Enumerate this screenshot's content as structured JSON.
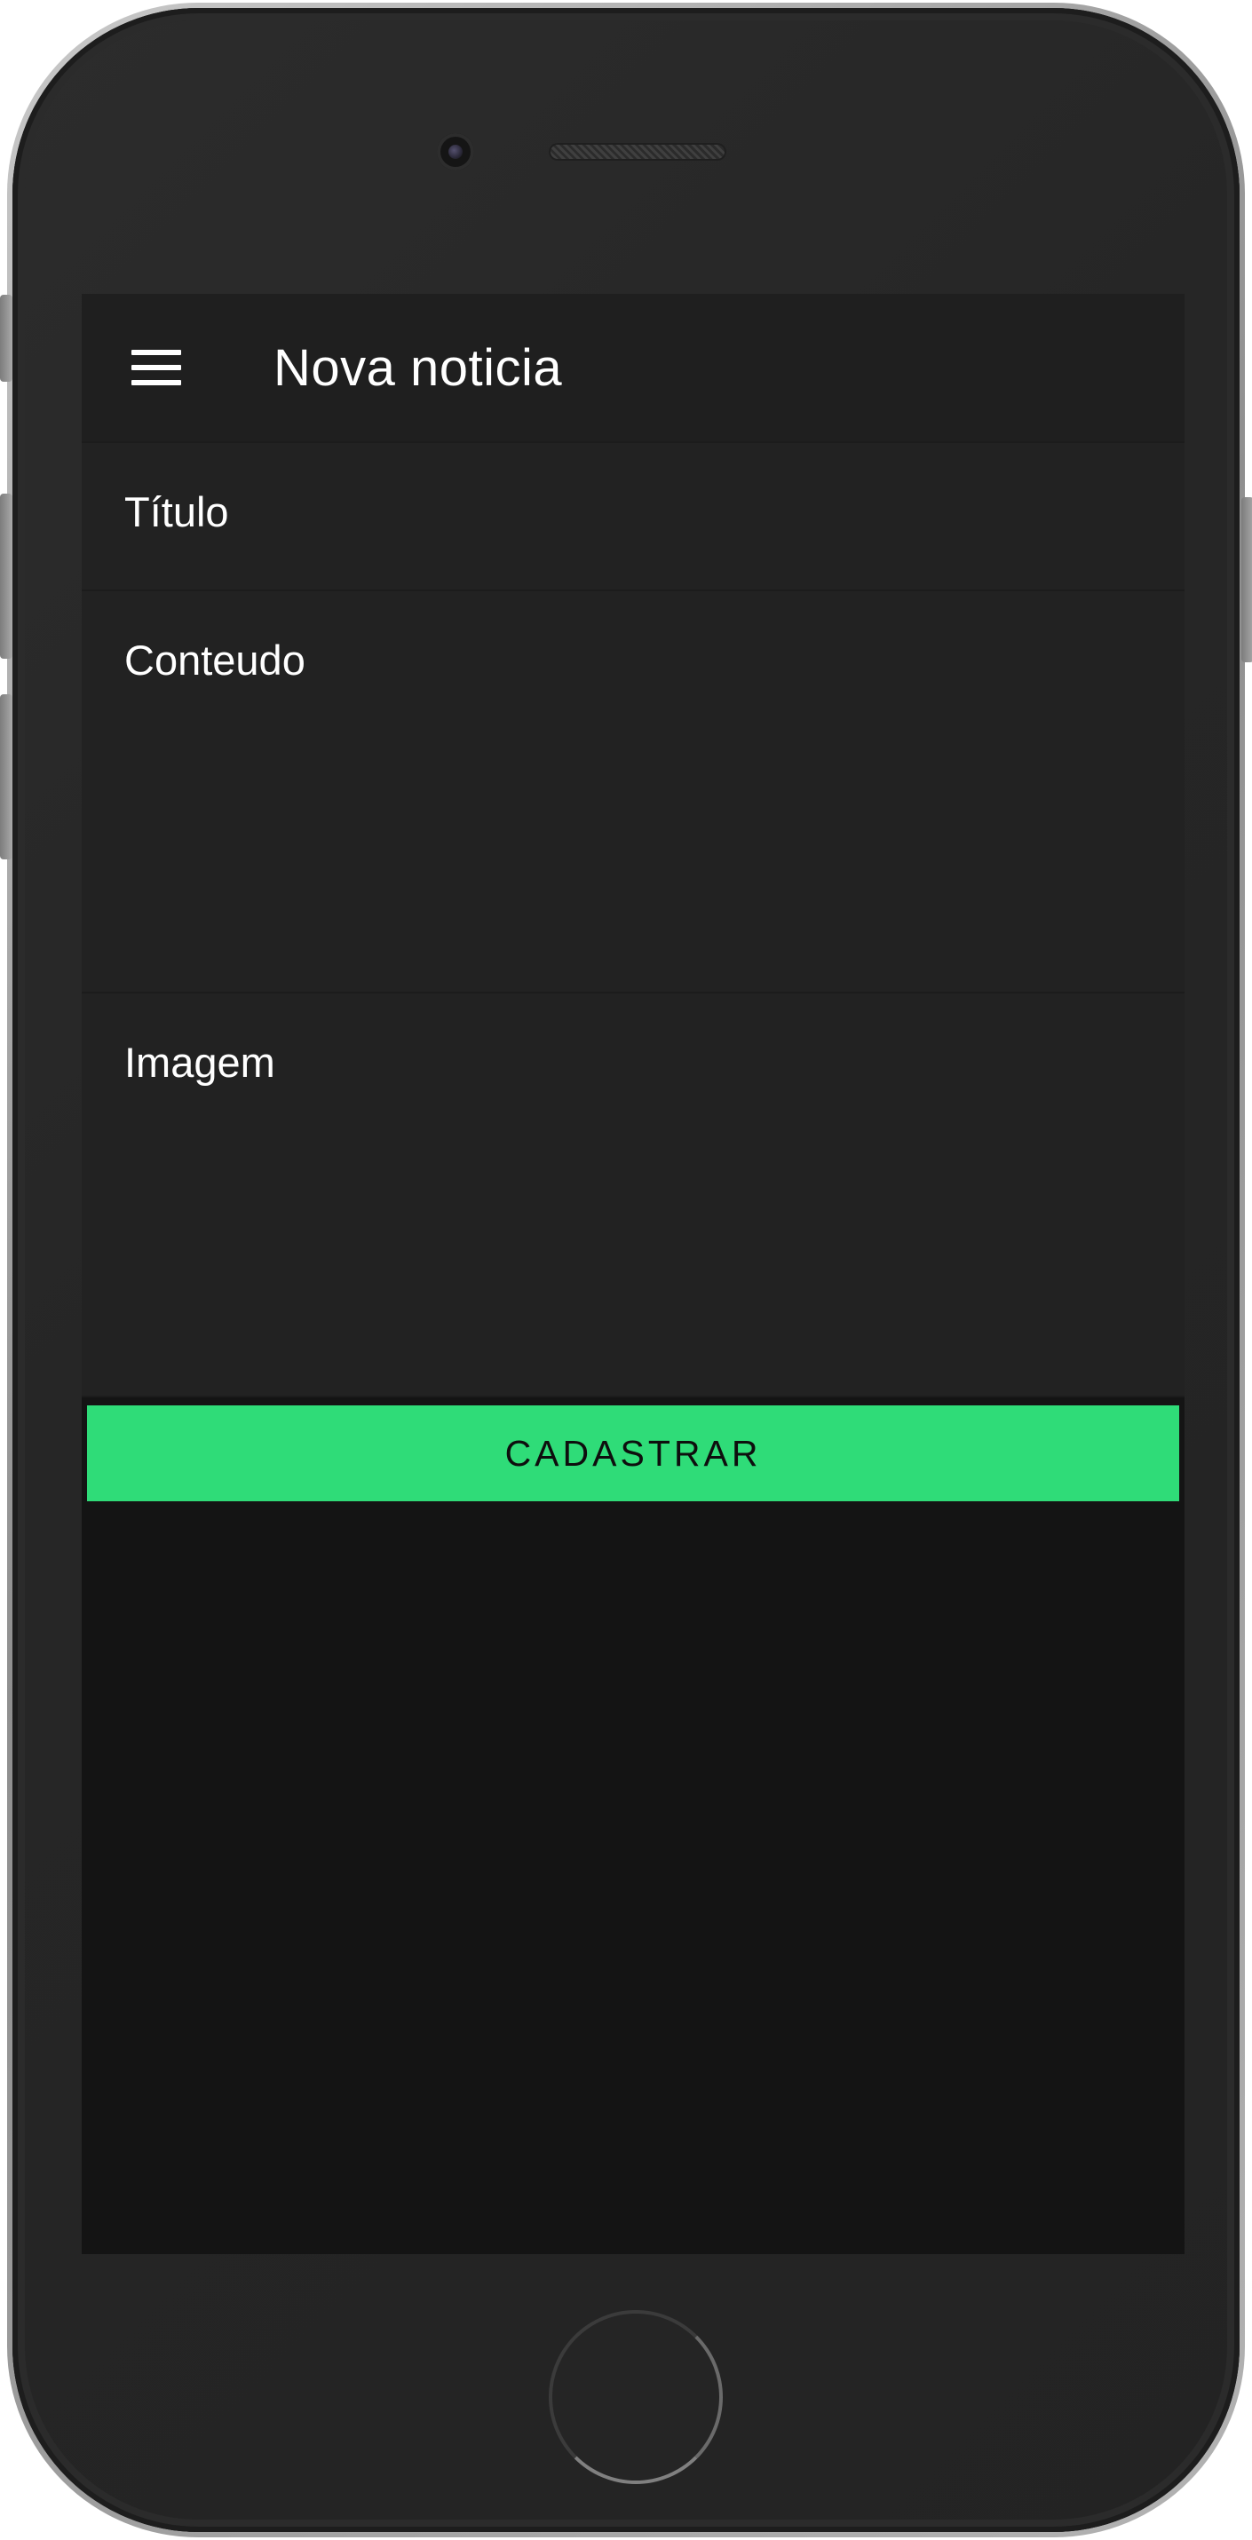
{
  "app": {
    "title": "Nova noticia",
    "menu_icon": "hamburger-menu-icon"
  },
  "form": {
    "title_label": "Título",
    "content_label": "Conteudo",
    "image_label": "Imagem",
    "submit_label": "CADASTRAR"
  },
  "colors": {
    "accent": "#2fdc78",
    "app_bar": "#1f1f1f",
    "field_background": "#222222",
    "screen_background": "#141414",
    "text": "#ffffff"
  }
}
